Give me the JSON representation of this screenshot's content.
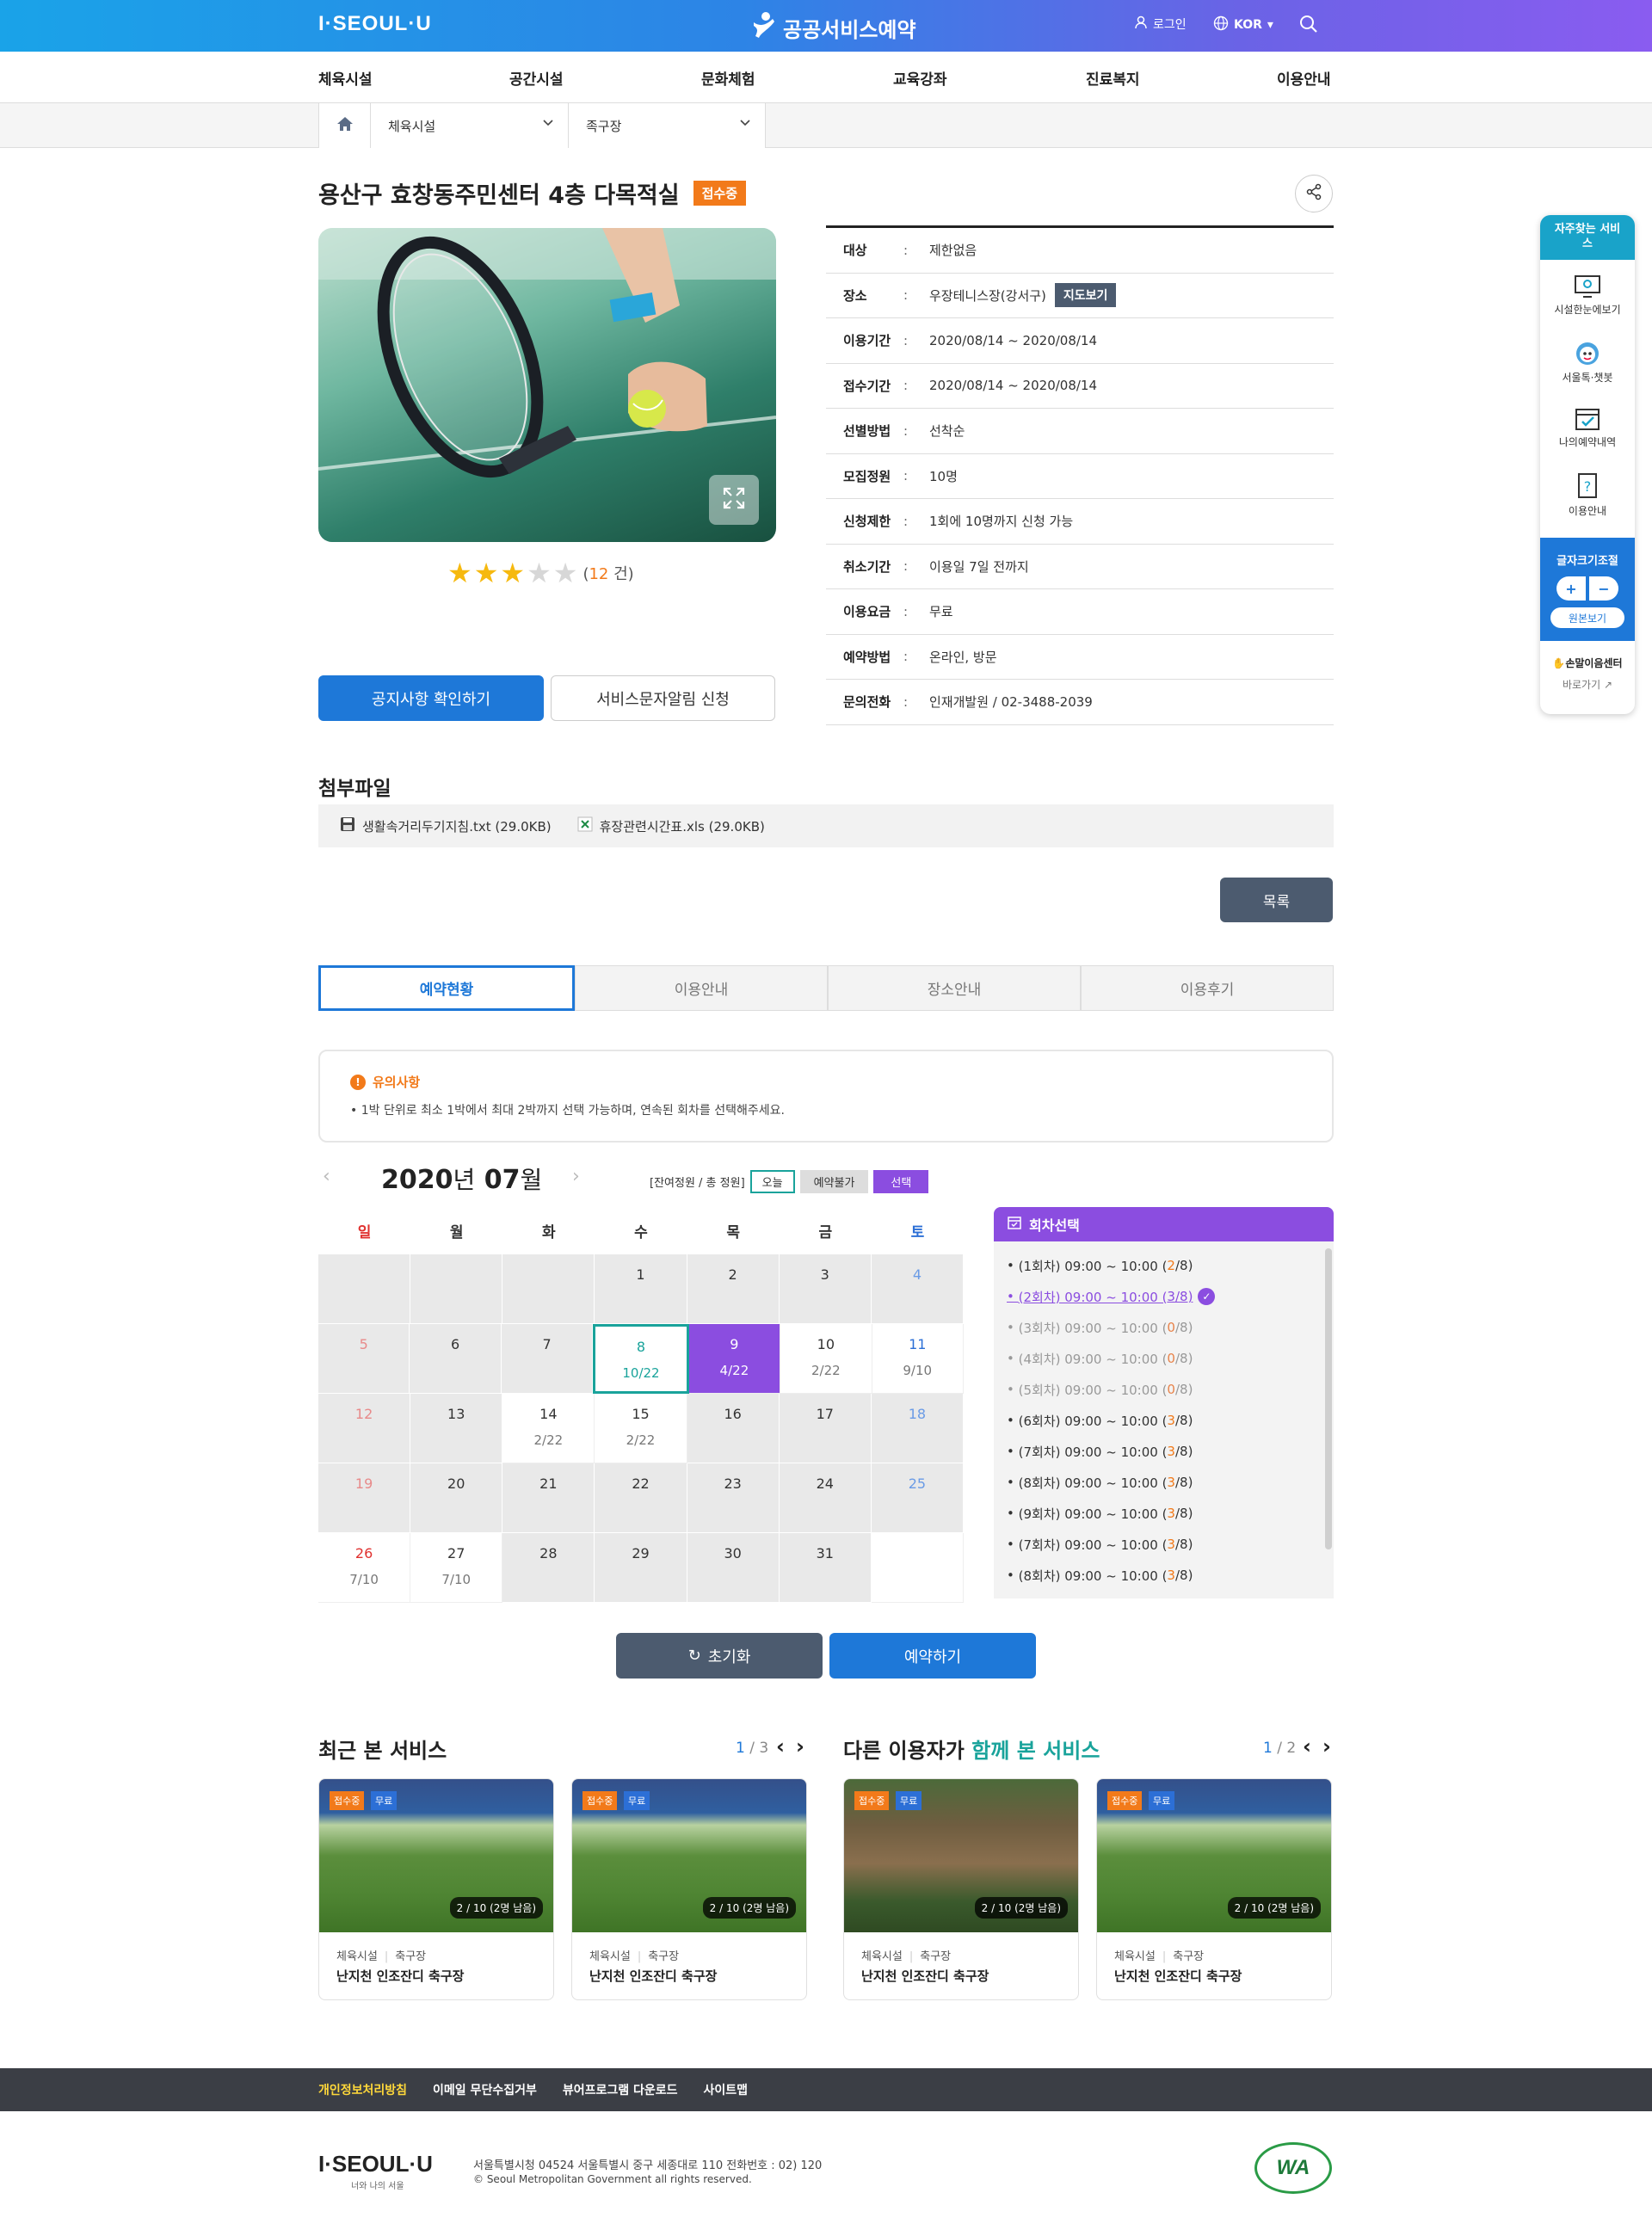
{
  "header": {
    "logo": "I·SEOUL·U",
    "service_name": "공공서비스예약",
    "login": "로그인",
    "lang": "KOR"
  },
  "gnb": [
    "체육시설",
    "공간시설",
    "문화체험",
    "교육강좌",
    "진료복지",
    "이용안내"
  ],
  "breadcrumb": {
    "level1": "체육시설",
    "level2": "족구장"
  },
  "detail": {
    "title": "용산구 효창동주민센터 4층 다목적실",
    "status": "접수중",
    "rating": {
      "stars": 3,
      "max": 5,
      "count": "12",
      "count_suffix": " 건"
    },
    "info": [
      {
        "k": "대상",
        "v": "제한없음"
      },
      {
        "k": "장소",
        "v": "우장테니스장(강서구)",
        "btn": "지도보기"
      },
      {
        "k": "이용기간",
        "v": "2020/08/14 ~ 2020/08/14"
      },
      {
        "k": "접수기간",
        "v": "2020/08/14 ~ 2020/08/14"
      },
      {
        "k": "선별방법",
        "v": "선착순"
      },
      {
        "k": "모집정원",
        "v": "10명"
      },
      {
        "k": "신청제한",
        "v": "1회에 10명까지 신청 가능"
      },
      {
        "k": "취소기간",
        "v": "이용일 7일 전까지"
      },
      {
        "k": "이용요금",
        "v": "무료"
      },
      {
        "k": "예약방법",
        "v": "온라인, 방문"
      },
      {
        "k": "문의전화",
        "v": "인재개발원 / 02-3488-2039"
      }
    ],
    "notice_btn": "공지사항 확인하기",
    "sms_btn": "서비스문자알림 신청"
  },
  "attachments": {
    "title": "첨부파일",
    "files": [
      "생활속거리두기지침.txt (29.0KB)",
      "휴장관련시간표.xls (29.0KB)"
    ]
  },
  "list_btn": "목록",
  "tabs": [
    "예약현황",
    "이용안내",
    "장소안내",
    "이용후기"
  ],
  "notice": {
    "title": "유의사항",
    "text": "• 1박 단위로 최소 1박에서 최대 2박까지 선택 가능하며, 연속된 회차를 선택해주세요."
  },
  "calendar": {
    "year": "2020",
    "year_unit": "년",
    "month": "07",
    "month_unit": "월",
    "legend": {
      "info": "[잔여정원 / 총 정원]",
      "today": "오늘",
      "unavailable": "예약불가",
      "selected": "선택"
    },
    "weekdays": [
      "일",
      "월",
      "화",
      "수",
      "목",
      "금",
      "토"
    ],
    "weeks": [
      [
        {
          "d": ""
        },
        {
          "d": ""
        },
        {
          "d": ""
        },
        {
          "d": "1"
        },
        {
          "d": "2"
        },
        {
          "d": "3"
        },
        {
          "d": "4"
        }
      ],
      [
        {
          "d": "5"
        },
        {
          "d": "6"
        },
        {
          "d": "7"
        },
        {
          "d": "8",
          "s": "10/22",
          "st": "today"
        },
        {
          "d": "9",
          "s": "4/22",
          "st": "sel"
        },
        {
          "d": "10",
          "s": "2/22",
          "st": "avail"
        },
        {
          "d": "11",
          "s": "9/10",
          "st": "avail"
        }
      ],
      [
        {
          "d": "12"
        },
        {
          "d": "13"
        },
        {
          "d": "14",
          "s": "2/22",
          "st": "avail"
        },
        {
          "d": "15",
          "s": "2/22",
          "st": "avail"
        },
        {
          "d": "16"
        },
        {
          "d": "17"
        },
        {
          "d": "18"
        }
      ],
      [
        {
          "d": "19"
        },
        {
          "d": "20"
        },
        {
          "d": "21"
        },
        {
          "d": "22"
        },
        {
          "d": "23"
        },
        {
          "d": "24"
        },
        {
          "d": "25"
        }
      ],
      [
        {
          "d": "26",
          "s": "7/10",
          "st": "avail"
        },
        {
          "d": "27",
          "s": "7/10",
          "st": "avail"
        },
        {
          "d": "28"
        },
        {
          "d": "29"
        },
        {
          "d": "30"
        },
        {
          "d": "31"
        },
        {
          "d": "",
          "st": "avail"
        }
      ]
    ]
  },
  "slots": {
    "title": "회차선택",
    "items": [
      {
        "t": "(1회차) 09:00 ~ 10:00 (",
        "r": "2",
        "tot": "/8)",
        "st": "normal"
      },
      {
        "t": "(2회차) 09:00 ~ 10:00 (",
        "r": "3",
        "tot": "/8)",
        "st": "sel"
      },
      {
        "t": "(3회차) 09:00 ~ 10:00 (",
        "r": "0",
        "tot": "/8)",
        "st": "dim"
      },
      {
        "t": "(4회차) 09:00 ~ 10:00 (",
        "r": "0",
        "tot": "/8)",
        "st": "dim"
      },
      {
        "t": "(5회차) 09:00 ~ 10:00 (",
        "r": "0",
        "tot": "/8)",
        "st": "dim"
      },
      {
        "t": "(6회차) 09:00 ~ 10:00 (",
        "r": "3",
        "tot": "/8)",
        "st": "normal"
      },
      {
        "t": "(7회차) 09:00 ~ 10:00 (",
        "r": "3",
        "tot": "/8)",
        "st": "normal"
      },
      {
        "t": "(8회차) 09:00 ~ 10:00 (",
        "r": "3",
        "tot": "/8)",
        "st": "normal"
      },
      {
        "t": "(9회차) 09:00 ~ 10:00 (",
        "r": "3",
        "tot": "/8)",
        "st": "normal"
      },
      {
        "t": "(7회차) 09:00 ~ 10:00 (",
        "r": "3",
        "tot": "/8)",
        "st": "normal"
      },
      {
        "t": "(8회차) 09:00 ~ 10:00 (",
        "r": "3",
        "tot": "/8)",
        "st": "normal"
      }
    ]
  },
  "reset_btn": "초기화",
  "reserve_btn": "예약하기",
  "recent": {
    "title": "최근 본 서비스",
    "page": "1",
    "total": "3"
  },
  "others": {
    "title_a": "다른 이용자가 ",
    "title_b": "함께 본 서비스",
    "page": "1",
    "total": "2"
  },
  "cards": [
    {
      "tag1": "접수중",
      "tag2": "무료",
      "count": "2 / 10 (2명 남음)",
      "cat": "체육시설",
      "sub": "축구장",
      "name": "난지천 인조잔디 축구장",
      "img": "stadium"
    },
    {
      "tag1": "접수중",
      "tag2": "무료",
      "count": "2 / 10 (2명 남음)",
      "cat": "체육시설",
      "sub": "축구장",
      "name": "난지천 인조잔디 축구장",
      "img": "stadium"
    },
    {
      "tag1": "접수중",
      "tag2": "무료",
      "count": "2 / 10 (2명 남음)",
      "cat": "체육시설",
      "sub": "축구장",
      "name": "난지천 인조잔디 축구장",
      "img": "forest"
    },
    {
      "tag1": "접수중",
      "tag2": "무료",
      "count": "2 / 10 (2명 남음)",
      "cat": "체육시설",
      "sub": "축구장",
      "name": "난지천 인조잔디 축구장",
      "img": "stadium"
    }
  ],
  "footer": {
    "links": [
      "개인정보처리방침",
      "이메일 무단수집거부",
      "뷰어프로그램 다운로드",
      "사이트맵"
    ],
    "logo": "I·SEOUL·U",
    "logo_sub": "너와 나의 서울",
    "address": "서울특별시청 04524 서울특별시 중구 세종대로 110 전화번호 : 02) 120",
    "copyright": "© Seoul Metropolitan Government all rights reserved.",
    "wa_mark": "WA"
  },
  "side": {
    "title": "자주찾는 서비스",
    "items": [
      "시설한눈에보기",
      "서울톡·챗봇",
      "나의예약내역",
      "이용안내"
    ],
    "font_title": "글자크기조절",
    "plus": "+",
    "minus": "−",
    "reset": "원본보기",
    "sign": "손말이음센터",
    "go": "바로가기"
  },
  "colors": {
    "primary": "#1e78d8",
    "purple": "#8b4de0",
    "orange": "#f27a1a",
    "teal": "#19a39b"
  }
}
